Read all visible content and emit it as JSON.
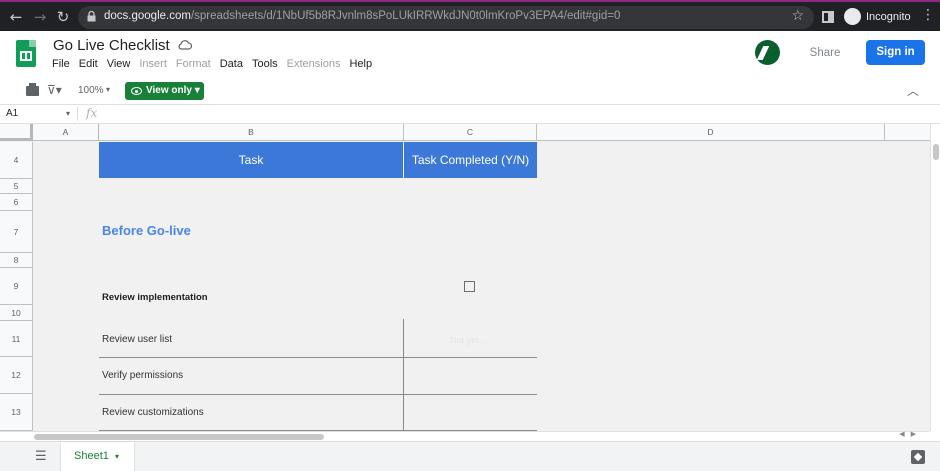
{
  "browser": {
    "url_host": "docs.google.com",
    "url_path": "/spreadsheets/d/1NbUf5b8RJvnlm8sPoLUkIRRWkdJN0t0lmKroPv3EPA4/edit#gid=0",
    "profile_label": "Incognito"
  },
  "doc": {
    "title": "Go Live Checklist",
    "share_label": "Share",
    "signin_label": "Sign in"
  },
  "menu": [
    "File",
    "Edit",
    "View",
    "Insert",
    "Format",
    "Data",
    "Tools",
    "Extensions",
    "Help"
  ],
  "menu_disabled": [
    "Insert",
    "Format",
    "Extensions"
  ],
  "toolbar": {
    "zoom": "100%",
    "view_only_label": "View only"
  },
  "formula_bar": {
    "cell_ref": "A1",
    "fx": "fx"
  },
  "columns": [
    "A",
    "B",
    "C",
    "D"
  ],
  "rows": [
    "4",
    "5",
    "6",
    "7",
    "8",
    "9",
    "10",
    "11",
    "12",
    "13"
  ],
  "sheet": {
    "task_header": "Task",
    "completed_header": "Task Completed (Y/N)",
    "section_title": "Before Go-live",
    "group_title": "Review implementation",
    "tasks": [
      "Review user list",
      "Verify permissions",
      "Review customizations"
    ],
    "faded_value": "Not yet..."
  },
  "tabs": {
    "active_sheet": "Sheet1"
  },
  "colors": {
    "header_blue": "#3c78d8",
    "section_blue": "#4a86e8",
    "view_only_green": "#188038",
    "signin_blue": "#1a73e8"
  }
}
